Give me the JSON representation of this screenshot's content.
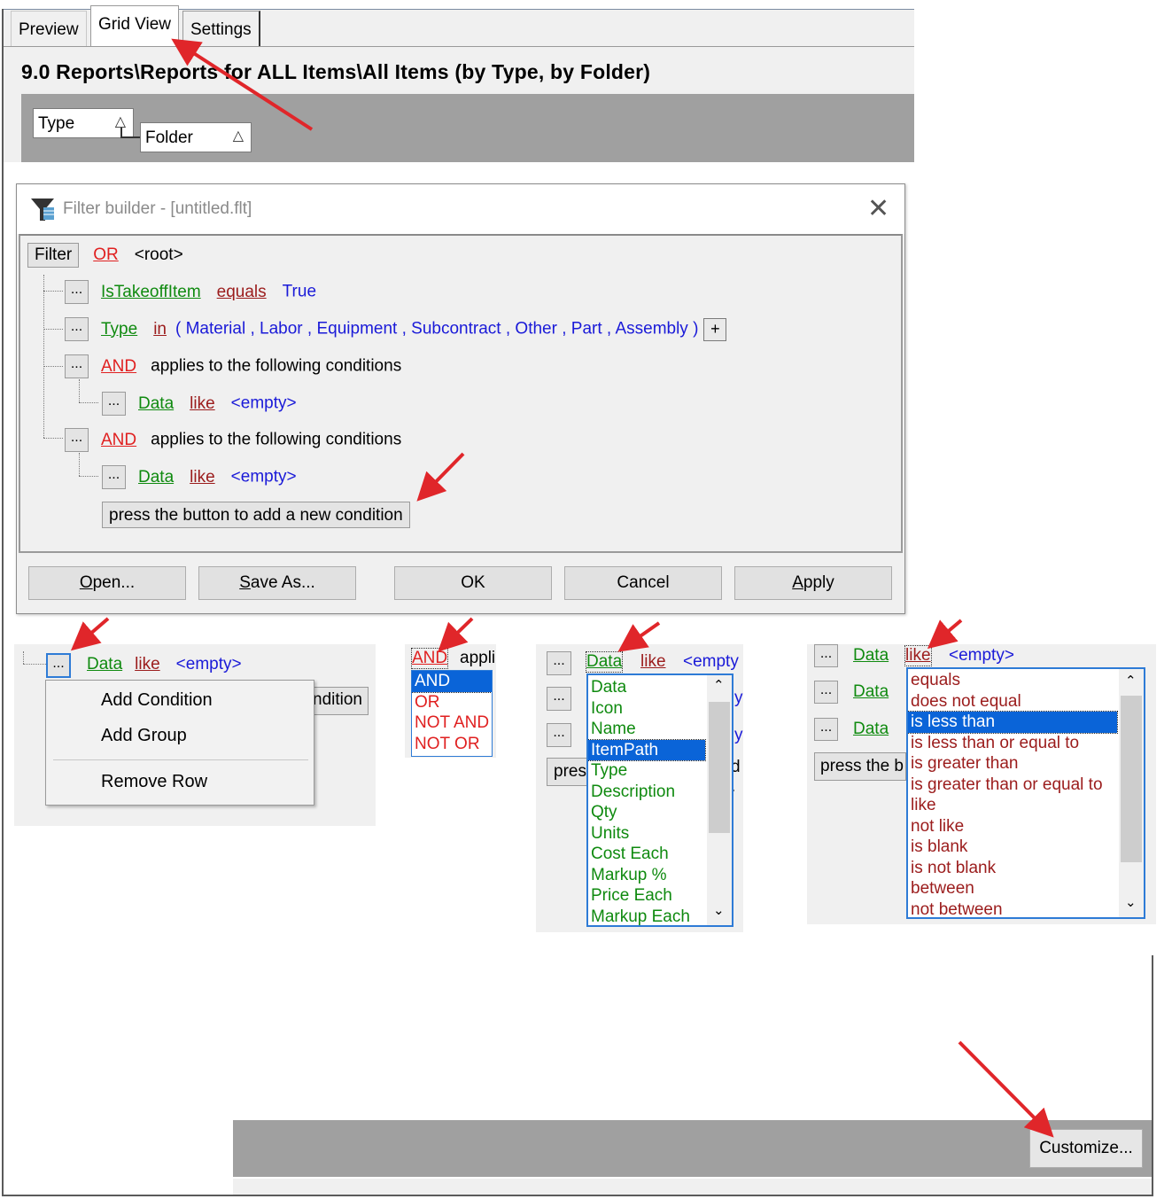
{
  "tabs": [
    "Preview",
    "Grid View",
    "Settings"
  ],
  "report_title": "9.0 Reports\\Reports for ALL Items\\All Items (by Type, by Folder)",
  "group_by": [
    "Type",
    "Folder"
  ],
  "sort_glyph": "△",
  "dialog": {
    "title": "Filter builder - [untitled.flt]",
    "filter_label": "Filter",
    "root_op": "OR",
    "root": "<root>",
    "row1": {
      "field": "IsTakeoffItem",
      "op": "equals",
      "value": "True"
    },
    "row2": {
      "field": "Type",
      "op": "in",
      "open": "(",
      "close": ")",
      "values": [
        "Material",
        "Labor",
        "Equipment",
        "Subcontract",
        "Other",
        "Part",
        "Assembly"
      ]
    },
    "group_op": "AND",
    "group_text": "applies to the following conditions",
    "cond": {
      "field": "Data",
      "op": "like",
      "value": "<empty>"
    },
    "add_condition": "press the button to add a new condition",
    "buttons": {
      "open": "Open...",
      "save_as": "Save As...",
      "ok": "OK",
      "cancel": "Cancel",
      "apply": "Apply"
    },
    "ellipsis": "...",
    "plus": "+"
  },
  "context_menu": {
    "items": [
      "Add Condition",
      "Add Group",
      "Remove Row"
    ],
    "behind_text": "ndition"
  },
  "group_op_dropdown": {
    "current": "AND",
    "behind_text": "appli",
    "options": [
      "AND",
      "OR",
      "NOT AND",
      "NOT OR"
    ],
    "selected": "AND"
  },
  "field_dropdown": {
    "current": "Data",
    "options": [
      "Data",
      "Icon",
      "Name",
      "ItemPath",
      "Type",
      "Description",
      "Qty",
      "Units",
      "Cost Each",
      "Markup %",
      "Price Each",
      "Markup Each"
    ],
    "selected": "ItemPath",
    "behind": {
      "press": "pres",
      "v1": "<empty",
      "y": "y",
      "d": "d ."
    }
  },
  "operator_dropdown": {
    "current": "like",
    "options": [
      "equals",
      "does not equal",
      "is less than",
      "is less than or equal to",
      "is greater than",
      "is greater than or equal to",
      "like",
      "not like",
      "is blank",
      "is not blank",
      "between",
      "not between"
    ],
    "selected": "is less than",
    "behind_press": "press the b"
  },
  "customize_label": "Customize...",
  "colors": {
    "accent": "#0a64d8",
    "field": "#0f8a0f",
    "logic": "#e02020",
    "operator": "#9b1c1c",
    "value": "#1a1ad8",
    "arrow": "#e0262a"
  }
}
